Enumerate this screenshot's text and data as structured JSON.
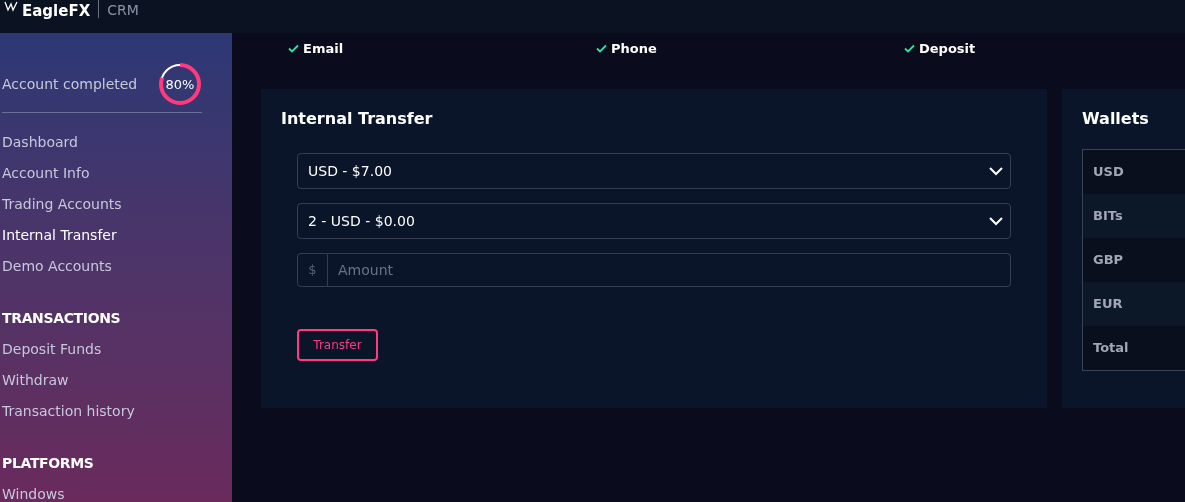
{
  "header": {
    "logo": "EagleFX",
    "product": "CRM"
  },
  "sidebar": {
    "progress": {
      "label": "Account completed",
      "reading": "80%"
    },
    "items": [
      {
        "label": "Dashboard",
        "selected": false
      },
      {
        "label": "Account Info",
        "selected": false
      },
      {
        "label": "Trading Accounts",
        "selected": false
      },
      {
        "label": "Internal Transfer",
        "selected": true
      },
      {
        "label": "Demo Accounts",
        "selected": false
      }
    ],
    "sections": [
      {
        "title": "TRANSACTIONS",
        "items": [
          {
            "label": "Deposit Funds",
            "selected": false
          },
          {
            "label": "Withdraw",
            "selected": false
          },
          {
            "label": "Transaction history",
            "selected": false
          }
        ]
      },
      {
        "title": "PLATFORMS",
        "items": [
          {
            "label": "Windows",
            "selected": false
          }
        ]
      }
    ]
  },
  "verifications": [
    {
      "label": "Email",
      "checked": true
    },
    {
      "label": "Phone",
      "checked": true
    },
    {
      "label": "Deposit",
      "checked": true
    }
  ],
  "transfer": {
    "title": "Internal Transfer",
    "from": "USD - $7.00",
    "to": "2 - USD - $0.00",
    "amount": {
      "prefix": "$",
      "placeholder": "Amount"
    },
    "button": "Transfer"
  },
  "wallets": {
    "title": "Wallets",
    "rows": [
      "USD",
      "BITs",
      "GBP",
      "EUR",
      "Total"
    ]
  }
}
